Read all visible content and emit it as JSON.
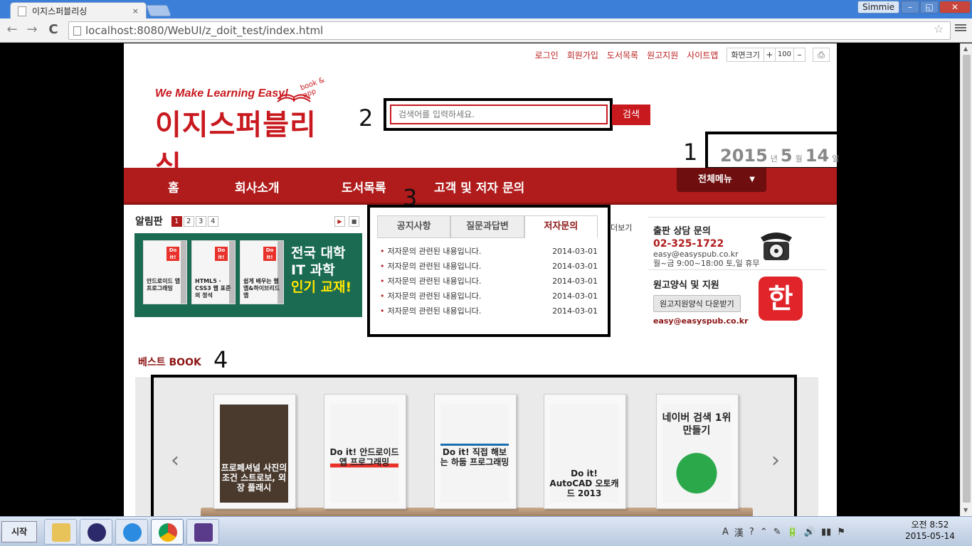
{
  "browser": {
    "tab_title": "이지스퍼블리싱",
    "tab_close": "×",
    "url": "localhost:8080/WebUI/z_doit_test/index.html",
    "user": "Simmie",
    "back": "←",
    "forward": "→",
    "reload": "C",
    "star": "☆",
    "min": "–",
    "max": "◱",
    "close": "✕"
  },
  "top_links": [
    "로그인",
    "회원가입",
    "도서목록",
    "원고지원",
    "사이트맵"
  ],
  "zoom": {
    "label": "화면크기",
    "plus": "+",
    "value": "100",
    "minus": "–"
  },
  "print_icon": "⎙",
  "logo": {
    "tagline": "We Make Learning Easy!",
    "brand": "이지스퍼블리싱",
    "sub": "book & app"
  },
  "search": {
    "placeholder": "검색어를 입력하세요.",
    "button": "검색"
  },
  "date": {
    "year": "2015",
    "year_unit": "년",
    "month": "5",
    "month_unit": "월",
    "day": "14",
    "day_unit": "일"
  },
  "annotations": [
    "1",
    "2",
    "3",
    "4"
  ],
  "gnb": [
    "홈",
    "회사소개",
    "도서목록",
    "고객 및 저자 문의"
  ],
  "all_menu": {
    "label": "전체메뉴",
    "arrow": "▼"
  },
  "notice": {
    "title": "알림판",
    "pages": [
      "1",
      "2",
      "3",
      "4"
    ],
    "play": "▶",
    "stop": "■",
    "banner_books": [
      {
        "do": "Do it!",
        "title": "안드로이드 앱 프로그래밍"
      },
      {
        "do": "Do it!",
        "title": "HTML5 · CSS3 웹 표준의 정석"
      },
      {
        "do": "Do it!",
        "title": "쉽게 배우는 웹앱&하이브리드앱"
      }
    ],
    "banner_copy": [
      "전국 대학",
      "IT 과학",
      "인기 교재!"
    ]
  },
  "tabs": {
    "items": [
      "공지사항",
      "질문과답변",
      "저자문의"
    ],
    "active": 2,
    "more": "더보기",
    "rows": [
      {
        "text": "저자문의 관련된 내용입니다.",
        "date": "2014-03-01"
      },
      {
        "text": "저자문의 관련된 내용입니다.",
        "date": "2014-03-01"
      },
      {
        "text": "저자문의 관련된 내용입니다.",
        "date": "2014-03-01"
      },
      {
        "text": "저자문의 관련된 내용입니다.",
        "date": "2014-03-01"
      },
      {
        "text": "저자문의 관련된 내용입니다.",
        "date": "2014-03-01"
      }
    ]
  },
  "contact": {
    "title": "출판 상담 문의",
    "phone": "02-325-1722",
    "email": "easy@easyspub.co.kr",
    "hours": "월~금 9:00~18:00 토,일 휴무",
    "manuscript_title": "원고양식 및 지원",
    "download_btn": "원고지원양식 다운받기",
    "email2": "easy@easyspub.co.kr",
    "hangul": "한"
  },
  "best": {
    "title": "베스트 BOOK",
    "prev": "‹",
    "next": "›",
    "books": [
      {
        "title": "프로페셔널 사진의 조건 스트로보, 외장 플래시",
        "color": "#4a3a2e"
      },
      {
        "title": "Do it! 안드로이드 앱 프로그래밍",
        "color": "#e8322b"
      },
      {
        "title": "Do it! 직접 해보는 하둡 프로그래밍",
        "color": "#1b6fb0"
      },
      {
        "title": "Do it! AutoCAD 오토캐드 2013",
        "color": "#e8322b"
      },
      {
        "title": "네이버 검색 1위 만들기",
        "color": "#2aa84a"
      }
    ]
  },
  "taskbar": {
    "start": "시작",
    "tray": [
      "A",
      "漢",
      "?",
      "⌃",
      "✎",
      "🔋",
      "🔊",
      "▮▮",
      "⚑"
    ],
    "clock_time": "오전 8:52",
    "clock_date": "2015-05-14"
  }
}
